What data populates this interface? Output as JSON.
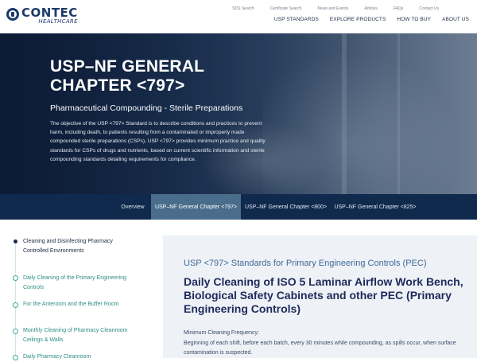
{
  "header": {
    "logo_name": "CONTEC",
    "logo_sub": "HEALTHCARE",
    "top_links": [
      "SDS Search",
      "Certificate Search",
      "News and Events",
      "Articles",
      "FAQs",
      "Contact Us"
    ],
    "main_nav": [
      "USP STANDARDS",
      "EXPLORE PRODUCTS",
      "HOW TO BUY",
      "ABOUT US"
    ]
  },
  "hero": {
    "title": "USP–NF GENERAL CHAPTER <797>",
    "subtitle": "Pharmaceutical Compounding - Sterile Preparations",
    "description": "The objective of the USP <797> Standard is to describe conditions and practices to prevent harm, including death, to patients resulting from a contaminated or improperly made compounded sterile preparations (CSPs). USP <797> provides minimum practice and quality standards for CSPs of drugs and nutrients, based on current scientific information and sterile compounding standards detailing requirements for compliance."
  },
  "tabs": [
    {
      "label": "Overview",
      "active": false
    },
    {
      "label": "USP–NF General Chapter <797>",
      "active": true
    },
    {
      "label": "USP–NF General Chapter <800>",
      "active": false
    },
    {
      "label": "USP–NF General Chapter <825>",
      "active": false
    }
  ],
  "sidebar": {
    "items": [
      {
        "label": "Cleaning and Disinfecting Pharmacy Controlled Environments",
        "current": true
      },
      {
        "label": "Daily Cleaning of the Primary Engineering Controls",
        "current": false
      },
      {
        "label": "For the Anteroom and the Buffer Room",
        "current": false
      },
      {
        "label": "Monthly Cleaning of Pharmacy Cleanroom Ceilings & Walls",
        "current": false
      },
      {
        "label": "Daily Pharmacy Cleanroom",
        "current": false
      }
    ]
  },
  "content": {
    "kicker": "USP <797> Standards for Primary Engineering Controls (PEC)",
    "title": "Daily Cleaning of ISO 5 Laminar Airflow Work Bench, Biological Safety Cabinets and other PEC (Primary Engineering Controls)",
    "label": "Minimum Cleaning Frequency:",
    "text": "Beginning of each shift, before each batch, every 30 minutes while compounding, as spills occur, when surface contamination is suspected."
  },
  "colors": {
    "brand_navy": "#1b3a6b",
    "tab_bar": "#0f2a4d",
    "tab_active": "#4a6d8c",
    "accent_teal": "#3fa79a",
    "panel_bg": "#eef1f6"
  }
}
